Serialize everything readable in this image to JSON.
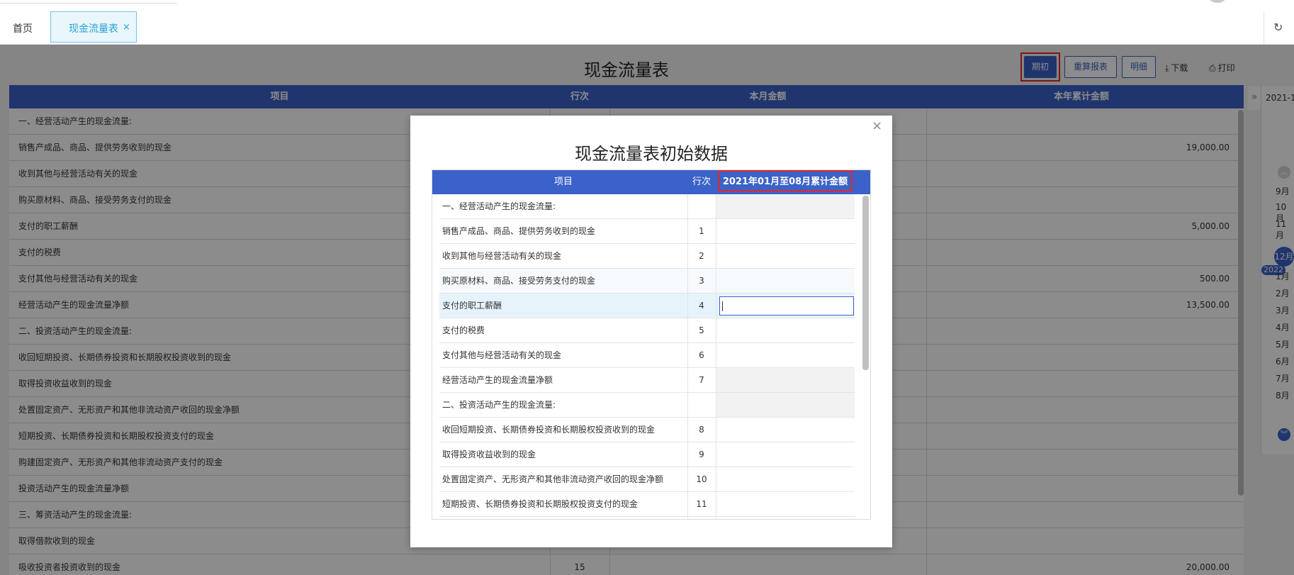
{
  "tabs": {
    "home": "首页",
    "active": "现金流量表",
    "close": "×"
  },
  "report": {
    "title": "现金流量表",
    "toolbar": {
      "opening": "期初",
      "recalc": "重算报表",
      "detail": "明细",
      "download": "下载",
      "print": "打印"
    },
    "columns": [
      "项目",
      "行次",
      "本月金额",
      "本年累计金额"
    ],
    "rows": [
      {
        "item": "一、经营活动产生的现金流量:",
        "line": "",
        "ytd": ""
      },
      {
        "item": "销售产成品、商品、提供劳务收到的现金",
        "line": "",
        "ytd": "19,000.00"
      },
      {
        "item": "收到其他与经营活动有关的现金",
        "line": "",
        "ytd": ""
      },
      {
        "item": "购买原材料、商品、接受劳务支付的现金",
        "line": "",
        "ytd": ""
      },
      {
        "item": "支付的职工薪酬",
        "line": "",
        "ytd": "5,000.00"
      },
      {
        "item": "支付的税费",
        "line": "",
        "ytd": ""
      },
      {
        "item": "支付其他与经营活动有关的现金",
        "line": "",
        "ytd": "500.00"
      },
      {
        "item": "经营活动产生的现金流量净额",
        "line": "",
        "ytd": "13,500.00"
      },
      {
        "item": "二、投资活动产生的现金流量:",
        "line": "",
        "ytd": ""
      },
      {
        "item": "收回短期投资、长期债券投资和长期股权投资收到的现金",
        "line": "",
        "ytd": ""
      },
      {
        "item": "取得投资收益收到的现金",
        "line": "",
        "ytd": ""
      },
      {
        "item": "处置固定资产、无形资产和其他非流动资产收回的现金净额",
        "line": "",
        "ytd": ""
      },
      {
        "item": "短期投资、长期债券投资和长期股权投资支付的现金",
        "line": "",
        "ytd": ""
      },
      {
        "item": "购建固定资产、无形资产和其他非流动资产支付的现金",
        "line": "",
        "ytd": ""
      },
      {
        "item": "投资活动产生的现金流量净额",
        "line": "",
        "ytd": ""
      },
      {
        "item": "三、筹资活动产生的现金流量:",
        "line": "",
        "ytd": ""
      },
      {
        "item": "取得借款收到的现金",
        "line": "",
        "ytd": ""
      },
      {
        "item": "吸收投资者投资收到的现金",
        "line": "15",
        "ytd": "20,000.00"
      }
    ]
  },
  "month_panel": {
    "year_label": "2021-1",
    "months_before": [
      "9月",
      "10月",
      "11月"
    ],
    "active": "12月",
    "year_badge": "2022",
    "months_after": [
      "1月",
      "2月",
      "3月",
      "4月",
      "5月",
      "6月",
      "7月",
      "8月"
    ]
  },
  "modal": {
    "title": "现金流量表初始数据",
    "close": "×",
    "columns": [
      "项目",
      "行次",
      "2021年01月至08月累计金额"
    ],
    "rows": [
      {
        "item": "一、经营活动产生的现金流量:",
        "line": "",
        "readonly": true
      },
      {
        "item": "销售产成品、商品、提供劳务收到的现金",
        "line": "1",
        "readonly": false
      },
      {
        "item": "收到其他与经营活动有关的现金",
        "line": "2",
        "readonly": false
      },
      {
        "item": "购买原材料、商品、接受劳务支付的现金",
        "line": "3",
        "readonly": false
      },
      {
        "item": "支付的职工薪酬",
        "line": "4",
        "readonly": false,
        "editing": true
      },
      {
        "item": "支付的税费",
        "line": "5",
        "readonly": false
      },
      {
        "item": "支付其他与经营活动有关的现金",
        "line": "6",
        "readonly": false
      },
      {
        "item": "经营活动产生的现金流量净额",
        "line": "7",
        "readonly": true
      },
      {
        "item": "二、投资活动产生的现金流量:",
        "line": "",
        "readonly": true
      },
      {
        "item": "收回短期投资、长期债券投资和长期股权投资收到的现金",
        "line": "8",
        "readonly": false
      },
      {
        "item": "取得投资收益收到的现金",
        "line": "9",
        "readonly": false
      },
      {
        "item": "处置固定资产、无形资产和其他非流动资产收回的现金净额",
        "line": "10",
        "readonly": false
      },
      {
        "item": "短期投资、长期债券投资和长期股权投资支付的现金",
        "line": "11",
        "readonly": false
      },
      {
        "item": "",
        "line": "",
        "readonly": false
      }
    ]
  },
  "colors": {
    "primary": "#3b62c8",
    "highlight": "#e52727",
    "tab_accent": "#2aa0d8"
  }
}
